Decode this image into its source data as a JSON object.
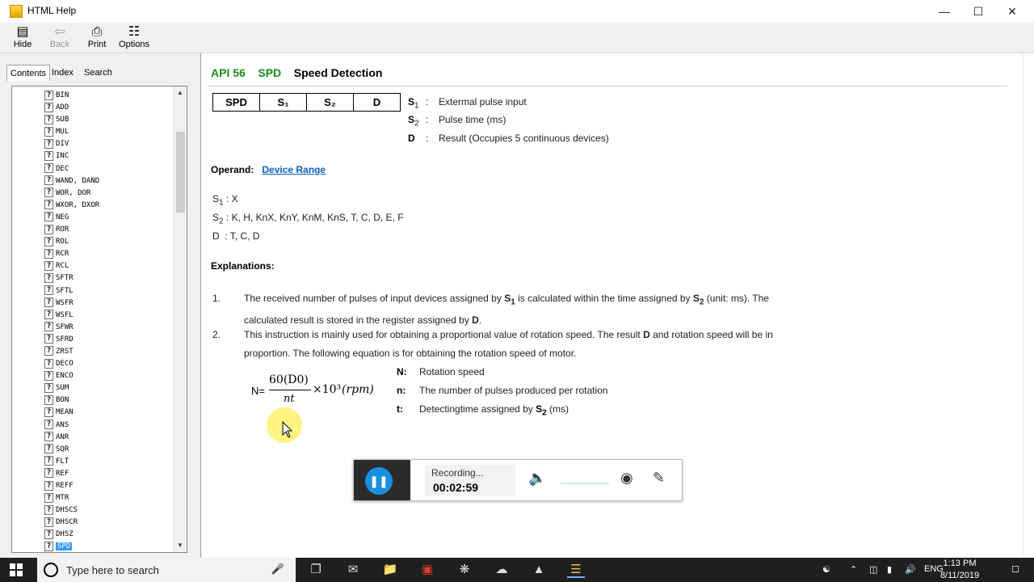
{
  "window": {
    "title": "HTML Help"
  },
  "toolbar": {
    "hide_label": "Hide",
    "back_label": "Back",
    "print_label": "Print",
    "options_label": "Options"
  },
  "nav": {
    "tabs": [
      "Contents",
      "Index",
      "Search"
    ],
    "active_tab": "Contents",
    "items": [
      "BIN",
      "ADD",
      "SUB",
      "MUL",
      "DIV",
      "INC",
      "DEC",
      "WAND, DAND",
      "WOR, DOR",
      "WXOR, DXOR",
      "NEG",
      "ROR",
      "ROL",
      "RCR",
      "RCL",
      "SFTR",
      "SFTL",
      "WSFR",
      "WSFL",
      "SFWR",
      "SFRD",
      "ZRST",
      "DECO",
      "ENCO",
      "SUM",
      "BON",
      "MEAN",
      "ANS",
      "ANR",
      "SQR",
      "FLT",
      "REF",
      "REFF",
      "MTR",
      "DHSCS",
      "DHSCR",
      "DHSZ",
      "SPD"
    ],
    "selected": "SPD"
  },
  "content": {
    "api": "API 56",
    "mnemonic": "SPD",
    "name": "Speed Detection",
    "operand_boxes": [
      "SPD",
      "S₁",
      "S₂",
      "D"
    ],
    "operand_desc": [
      {
        "sym": "S",
        "sub": "1",
        "text": "Extermal pulse input"
      },
      {
        "sym": "S",
        "sub": "2",
        "text": "Pulse time (ms)"
      },
      {
        "sym": "D",
        "sub": "",
        "text": "Result (Occupies 5 continuous devices)"
      }
    ],
    "operand_label": "Operand:",
    "device_range_link": "Device Range",
    "ranges": [
      {
        "sym": "S",
        "sub": "1",
        "text": ": X"
      },
      {
        "sym": "S",
        "sub": "2",
        "text": ": K, H, KnX, KnY, KnM, KnS, T, C, D, E, F"
      },
      {
        "sym": "D",
        "sub": "",
        "text": ": T, C, D"
      }
    ],
    "explanations_label": "Explanations:",
    "exp1": {
      "num": "1.",
      "a": "The received number of pulses of input devices assigned by ",
      "b": " is calculated within the time assigned by ",
      "c": " (unit: ms). The",
      "line2a": "calculated result is stored in the register assigned by ",
      "line2b": "D",
      "line2c": "."
    },
    "exp2": {
      "num": "2.",
      "a": "This instruction is mainly used for obtaining a proportional value of rotation speed. The result ",
      "b": "D",
      "c": " and rotation speed will be in",
      "line2": "proportion. The following equation is for obtaining the rotation speed of motor."
    },
    "formula": {
      "lhs": "N=",
      "num": "60(D0)",
      "den": "nt",
      "tail": "×10³",
      "unit": "(rpm)"
    },
    "legend": [
      {
        "key": "N:",
        "text": "Rotation speed"
      },
      {
        "key": "n:",
        "text": "The number of pulses produced per rotation"
      },
      {
        "key": "t:",
        "text": "Detectingtime assigned by ",
        "sym": "S",
        "sub": "2",
        "tail": " (ms)"
      }
    ]
  },
  "recorder": {
    "status": "Recording...",
    "time": "00:02:59"
  },
  "taskbar": {
    "search_placeholder": "Type here to search",
    "language": "ENG",
    "time": "1:13 PM",
    "date": "8/11/2019"
  }
}
